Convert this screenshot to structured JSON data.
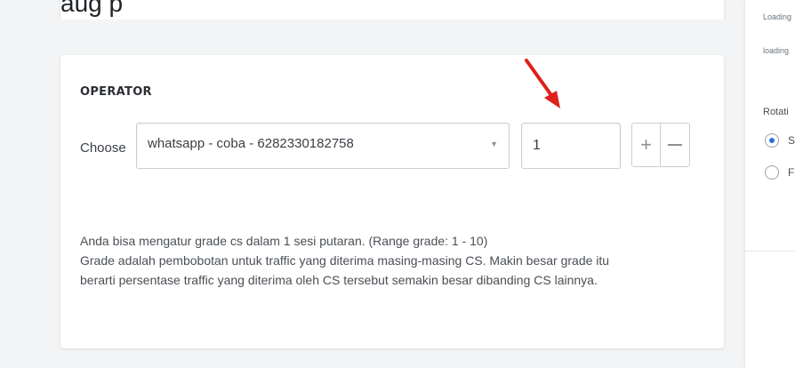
{
  "top_fragment": {
    "text": "aug p"
  },
  "operator": {
    "title": "OPERATOR",
    "choose_label": "Choose",
    "selected_operator": "whatsapp - coba - 6282330182758",
    "grade_value": "1",
    "plus_label": "+",
    "help_lines": [
      "Anda bisa mengatur grade cs dalam 1 sesi putaran. (Range grade: 1 - 10)",
      "Grade adalah pembobotan untuk traffic yang diterima masing-masing CS. Makin besar grade itu",
      "berarti persentase traffic yang diterima oleh CS tersebut semakin besar dibanding CS lainnya."
    ]
  },
  "right_panel": {
    "loading_1": "Loading",
    "loading_2": "loading",
    "rotation_label": "Rotati",
    "option_1": "S",
    "option_2": "F"
  },
  "colors": {
    "annotation_arrow": "#e0201b",
    "radio_checked": "#2f6fd8"
  }
}
